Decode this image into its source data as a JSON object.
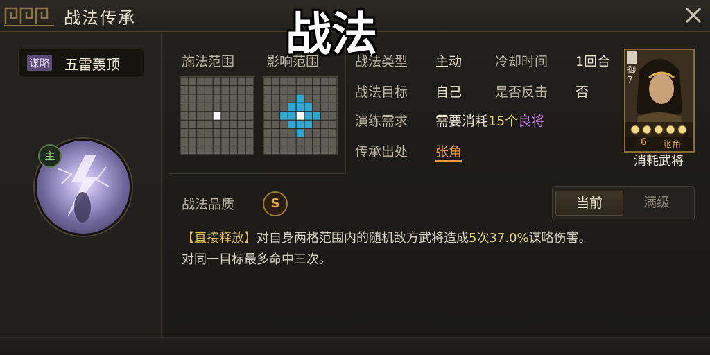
{
  "window": {
    "title": "战法传承",
    "overlay_caption": "战法",
    "close_icon": "close-icon"
  },
  "skill": {
    "type_tag": "谋略",
    "name": "五雷轰顶",
    "main_badge": "主",
    "icon": "lightning-strike-icon"
  },
  "range": {
    "cast_label": "施法范围",
    "effect_label": "影响范围"
  },
  "info": {
    "type_label": "战法类型",
    "type_value": "主动",
    "cooldown_label": "冷却时间",
    "cooldown_value": "1回合",
    "target_label": "战法目标",
    "target_value": "自己",
    "counter_label": "是否反击",
    "counter_value": "否",
    "training_label": "演练需求",
    "training_prefix": "需要消耗",
    "training_count": "15个",
    "training_suffix": "良将",
    "source_label": "传承出处",
    "source_value": "张角"
  },
  "general_card": {
    "caption": "消耗武将",
    "name": "张角",
    "cost": "6",
    "level_tag": "御",
    "level_num": "7",
    "stars": 5
  },
  "quality": {
    "label": "战法品质",
    "grade": "S"
  },
  "toggle": {
    "current": "当前",
    "max": "满级"
  },
  "description": {
    "tag": "【直接释放】",
    "part1": "对自身两格范围内的随机敌方武将造成",
    "times": "5次",
    "percent": "37.0%",
    "part2": "谋略伤害。",
    "line2": "对同一目标最多命中三次。"
  },
  "colors": {
    "accent_gold": "#e3a84c",
    "highlight_cell": "#2fa6d4",
    "purple": "#c67ce6",
    "orange": "#e89a42"
  }
}
